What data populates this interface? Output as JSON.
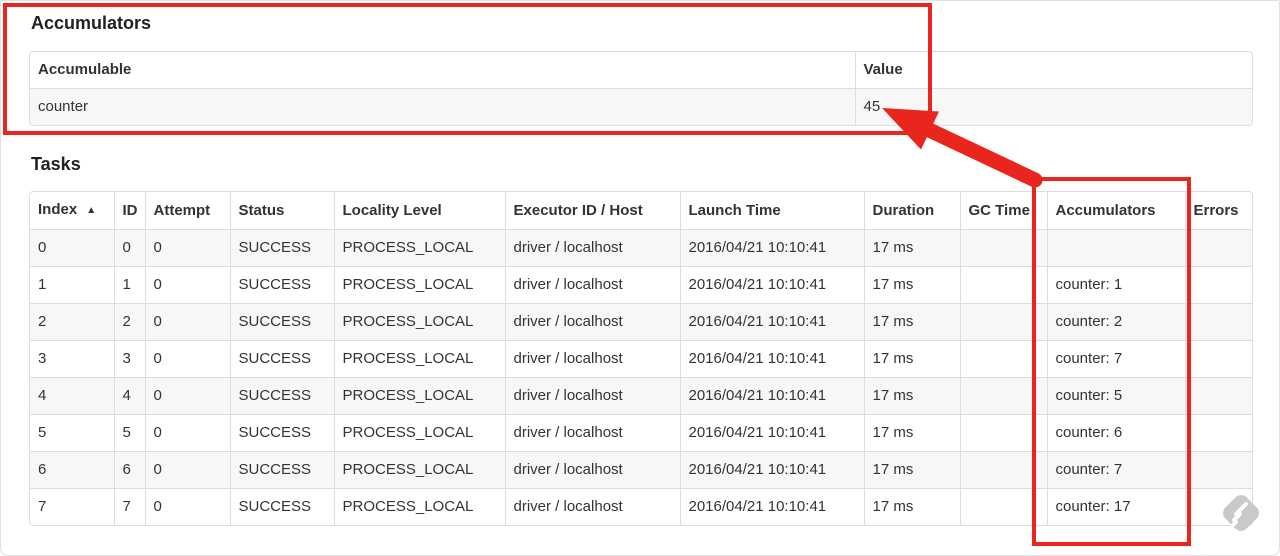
{
  "accumulators_section": {
    "title": "Accumulators",
    "table": {
      "columns": [
        "Accumulable",
        "Value"
      ],
      "rows": [
        [
          "counter",
          "45"
        ]
      ]
    }
  },
  "tasks_section": {
    "title": "Tasks",
    "table": {
      "columns": [
        "Index",
        "ID",
        "Attempt",
        "Status",
        "Locality Level",
        "Executor ID / Host",
        "Launch Time",
        "Duration",
        "GC Time",
        "Accumulators",
        "Errors"
      ],
      "sort_column": "Index",
      "sort_icon": "▲",
      "rows": [
        [
          "0",
          "0",
          "0",
          "SUCCESS",
          "PROCESS_LOCAL",
          "driver / localhost",
          "2016/04/21 10:10:41",
          "17 ms",
          "",
          "",
          ""
        ],
        [
          "1",
          "1",
          "0",
          "SUCCESS",
          "PROCESS_LOCAL",
          "driver / localhost",
          "2016/04/21 10:10:41",
          "17 ms",
          "",
          "counter: 1",
          ""
        ],
        [
          "2",
          "2",
          "0",
          "SUCCESS",
          "PROCESS_LOCAL",
          "driver / localhost",
          "2016/04/21 10:10:41",
          "17 ms",
          "",
          "counter: 2",
          ""
        ],
        [
          "3",
          "3",
          "0",
          "SUCCESS",
          "PROCESS_LOCAL",
          "driver / localhost",
          "2016/04/21 10:10:41",
          "17 ms",
          "",
          "counter: 7",
          ""
        ],
        [
          "4",
          "4",
          "0",
          "SUCCESS",
          "PROCESS_LOCAL",
          "driver / localhost",
          "2016/04/21 10:10:41",
          "17 ms",
          "",
          "counter: 5",
          ""
        ],
        [
          "5",
          "5",
          "0",
          "SUCCESS",
          "PROCESS_LOCAL",
          "driver / localhost",
          "2016/04/21 10:10:41",
          "17 ms",
          "",
          "counter: 6",
          ""
        ],
        [
          "6",
          "6",
          "0",
          "SUCCESS",
          "PROCESS_LOCAL",
          "driver / localhost",
          "2016/04/21 10:10:41",
          "17 ms",
          "",
          "counter: 7",
          ""
        ],
        [
          "7",
          "7",
          "0",
          "SUCCESS",
          "PROCESS_LOCAL",
          "driver / localhost",
          "2016/04/21 10:10:41",
          "17 ms",
          "",
          "counter: 17",
          ""
        ]
      ]
    }
  },
  "annotations": {
    "highlighted_value": "45",
    "box_targets": [
      "accumulators-summary-table",
      "tasks-accumulators-column"
    ]
  },
  "icons": {
    "sort_ascending": "▲",
    "watermark": "gray-diamond-marker"
  },
  "colors": {
    "annotation_red": "#e8261d",
    "table_border": "#dddddd",
    "row_stripe": "#f7f7f7",
    "text": "#333333"
  }
}
